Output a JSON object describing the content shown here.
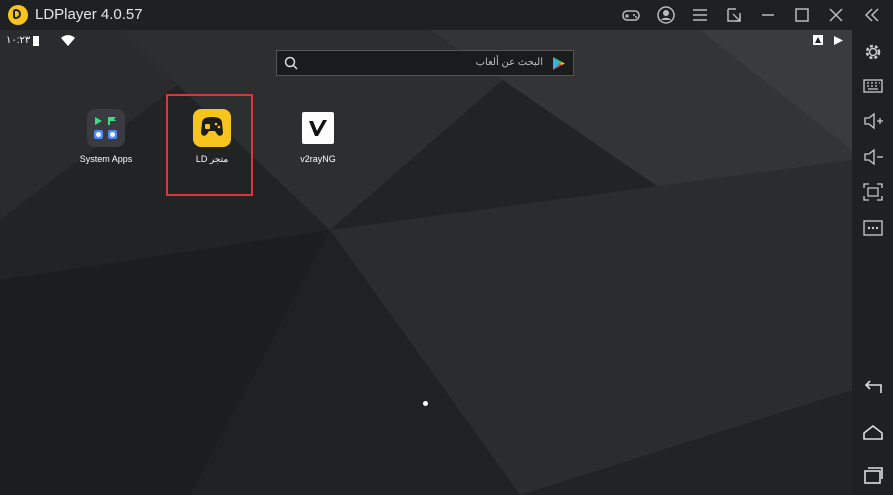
{
  "window": {
    "title": "LDPlayer 4.0.57"
  },
  "titlebar_icons": [
    "gamepad-icon",
    "user-icon",
    "menu-icon",
    "resize-icon",
    "minimize-icon",
    "maximize-icon",
    "close-icon",
    "collapse-icon"
  ],
  "status_bar": {
    "time": "١٠:٢٣",
    "icons": [
      "battery-icon",
      "wifi-icon",
      "notification-icon",
      "play-status-icon"
    ]
  },
  "search": {
    "placeholder": "البحث عن ألعاب"
  },
  "apps": [
    {
      "label": "System Apps",
      "icon": "system-apps-icon"
    },
    {
      "label": "LD متجر",
      "icon": "ld-store-icon"
    },
    {
      "label": "v2rayNG",
      "icon": "v2rayng-icon"
    }
  ],
  "sidebar_icons": [
    "settings-icon",
    "keyboard-icon",
    "volume-up-icon",
    "volume-down-icon",
    "fullscreen-icon",
    "more-icon",
    "back-icon",
    "home-icon",
    "recent-apps-icon"
  ],
  "colors": {
    "highlight": "#e0343b",
    "ld_yellow": "#f6c41c",
    "titlebar": "#1f2022"
  }
}
